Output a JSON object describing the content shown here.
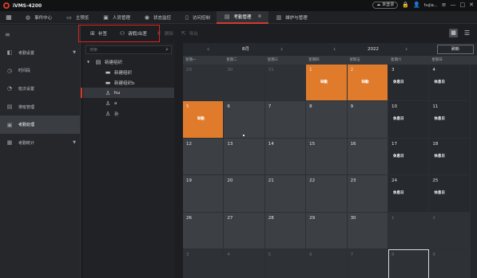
{
  "app": {
    "title": "iVMS-4200",
    "cloud_label": "未登录",
    "user": "hujia..."
  },
  "nav_tabs": [
    {
      "label": "事件中心",
      "icon": "bell-icon"
    },
    {
      "label": "主预览",
      "icon": "monitor-icon"
    },
    {
      "label": "人员管理",
      "icon": "person-card-icon"
    },
    {
      "label": "状态监控",
      "icon": "status-monitor-icon"
    },
    {
      "label": "访问控制",
      "icon": "door-icon"
    },
    {
      "label": "考勤管理",
      "icon": "attendance-icon",
      "active": true
    },
    {
      "label": "维护与管理",
      "icon": "maintenance-icon"
    }
  ],
  "sidebar": {
    "items": [
      {
        "label": "考勤设置",
        "icon": "attendance-settings-icon",
        "has_caret": true
      },
      {
        "label": "时间段",
        "icon": "clock-icon"
      },
      {
        "label": "班次设置",
        "icon": "shift-icon"
      },
      {
        "label": "排班管理",
        "icon": "schedule-icon"
      },
      {
        "label": "考勤处理",
        "icon": "attendance-process-icon",
        "active": true
      },
      {
        "label": "考勤统计",
        "icon": "statistics-icon",
        "has_caret": true
      }
    ]
  },
  "toolbar": {
    "add_label": "补签",
    "leave_label": "请假/出差",
    "delete_label": "删除",
    "export_label": "导出"
  },
  "tree": {
    "search_placeholder": "搜索",
    "nodes": [
      {
        "label": "新建组织",
        "level": 0,
        "type": "org",
        "expanded": true
      },
      {
        "label": "新建组织",
        "level": 1,
        "type": "folder"
      },
      {
        "label": "新建组织b",
        "level": 1,
        "type": "folder"
      },
      {
        "label": "hu",
        "level": 1,
        "type": "person",
        "active": true
      },
      {
        "label": "a",
        "level": 1,
        "type": "person"
      },
      {
        "label": "孙",
        "level": 1,
        "type": "person"
      }
    ]
  },
  "calendar": {
    "month": "8月",
    "year": "2022",
    "refresh_label": "刷新",
    "weekdays": [
      "星期一",
      "星期二",
      "星期三",
      "星期四",
      "星期五",
      "星期六",
      "星期日"
    ],
    "days": [
      {
        "num": "29",
        "kind": "other"
      },
      {
        "num": "30",
        "kind": "other"
      },
      {
        "num": "31",
        "kind": "other"
      },
      {
        "num": "1",
        "kind": "abnormal",
        "status": "缺勤"
      },
      {
        "num": "2",
        "kind": "abnormal",
        "status": "缺勤"
      },
      {
        "num": "3",
        "kind": "rest",
        "status": "休息日"
      },
      {
        "num": "4",
        "kind": "rest",
        "status": "休息日"
      },
      {
        "num": "5",
        "kind": "abnormal",
        "status": "缺勤"
      },
      {
        "num": "6",
        "kind": "normal",
        "mark": true
      },
      {
        "num": "7",
        "kind": "normal"
      },
      {
        "num": "8",
        "kind": "normal"
      },
      {
        "num": "9",
        "kind": "normal"
      },
      {
        "num": "10",
        "kind": "rest",
        "status": "休息日"
      },
      {
        "num": "11",
        "kind": "rest",
        "status": "休息日"
      },
      {
        "num": "12",
        "kind": "normal"
      },
      {
        "num": "13",
        "kind": "normal"
      },
      {
        "num": "14",
        "kind": "normal"
      },
      {
        "num": "15",
        "kind": "normal"
      },
      {
        "num": "16",
        "kind": "normal"
      },
      {
        "num": "17",
        "kind": "rest",
        "status": "休息日"
      },
      {
        "num": "18",
        "kind": "rest",
        "status": "休息日"
      },
      {
        "num": "19",
        "kind": "normal"
      },
      {
        "num": "20",
        "kind": "normal"
      },
      {
        "num": "21",
        "kind": "normal"
      },
      {
        "num": "22",
        "kind": "normal"
      },
      {
        "num": "23",
        "kind": "normal"
      },
      {
        "num": "24",
        "kind": "rest",
        "status": "休息日"
      },
      {
        "num": "25",
        "kind": "rest",
        "status": "休息日"
      },
      {
        "num": "26",
        "kind": "normal"
      },
      {
        "num": "27",
        "kind": "normal"
      },
      {
        "num": "28",
        "kind": "normal"
      },
      {
        "num": "29",
        "kind": "normal"
      },
      {
        "num": "30",
        "kind": "normal"
      },
      {
        "num": "1",
        "kind": "other"
      },
      {
        "num": "2",
        "kind": "other"
      },
      {
        "num": "3",
        "kind": "other"
      },
      {
        "num": "4",
        "kind": "other"
      },
      {
        "num": "5",
        "kind": "other"
      },
      {
        "num": "6",
        "kind": "other"
      },
      {
        "num": "7",
        "kind": "other"
      },
      {
        "num": "8",
        "kind": "other",
        "selected": true
      },
      {
        "num": "9",
        "kind": "other"
      }
    ]
  },
  "colors": {
    "accent": "#d33a2c",
    "abnormal": "#e07b2c",
    "highlight_box": "#e02222"
  }
}
